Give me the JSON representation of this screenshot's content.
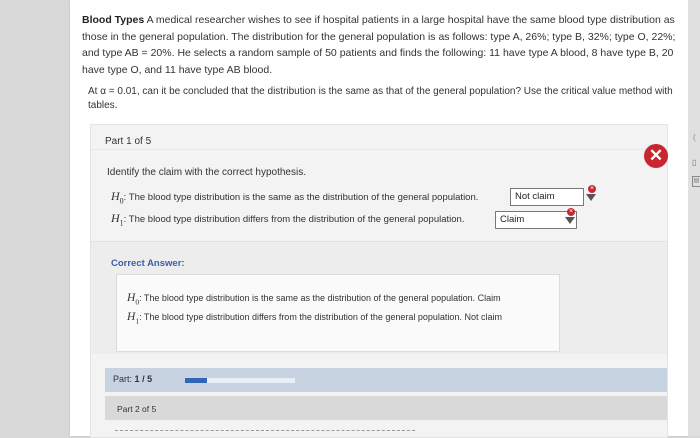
{
  "problem": {
    "title": "Blood Types",
    "text": "A medical researcher wishes to see if hospital patients in a large hospital have the same blood type distribution as those in the general population. The distribution for the general population is as follows: type A, 26%; type B, 32%; type O, 22%; and type AB = 20%. He selects a random sample of 50 patients and finds the following: 11 have type A blood, 8 have type B, 20 have type O, and 11 have type AB blood."
  },
  "question": "At α = 0.01, can it be concluded that the distribution is the same as that of the general population? Use the critical value method with tables.",
  "part": {
    "label": "Part 1 of 5",
    "prompt": "Identify the claim with the correct hypothesis.",
    "h0_symbol": "H",
    "h0_sub": "0",
    "h0_text": ": The blood type distribution is the same as the distribution of the general population.",
    "h0_selected": "Not claim",
    "h1_symbol": "H",
    "h1_sub": "1",
    "h1_text": ": The blood type distribution differs from the distribution of the general population.",
    "h1_selected": "Claim",
    "status": "incorrect"
  },
  "correct_answer": {
    "heading": "Correct Answer:",
    "h0_text": ": The blood type distribution is the same as the distribution of the general population.",
    "h0_answer": "Claim",
    "h1_text": ": The blood type distribution differs from the distribution of the general population.",
    "h1_answer": "Not claim"
  },
  "progress": {
    "label": "Part:",
    "current": "1",
    "separator": "/",
    "total": "5",
    "fraction": 0.2
  },
  "next_part": {
    "label": "Part 2 of 5"
  },
  "colors": {
    "error": "#c8272f",
    "accent": "#3264b8",
    "heading": "#3a5ea8"
  },
  "icons": {
    "incorrect": "close-icon",
    "dropdown": "caret-down-icon"
  }
}
